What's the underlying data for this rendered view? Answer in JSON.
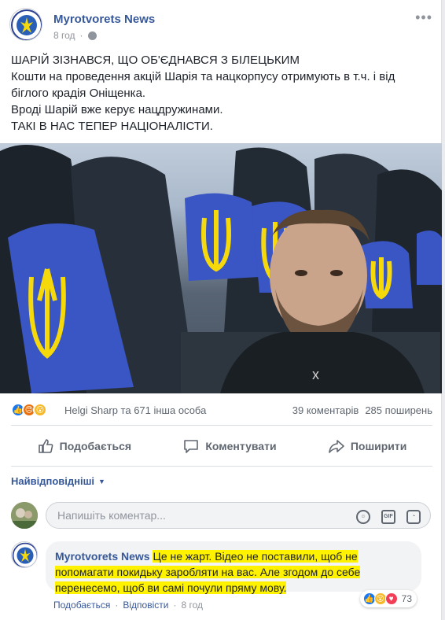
{
  "post": {
    "page_name": "Myrotvorets News",
    "time": "8 год",
    "text_lines": [
      "ШАРІЙ ЗІЗНАВСЯ, ЩО ОБ'ЄДНАВСЯ З БІЛЕЦЬКИМ",
      "Кошти на проведення акцій Шарія та нацкорпусу отримують в т.ч. і від",
      "біглого крадія Оніщенка.",
      "Вроді Шарій вже керує нацдружинами.",
      "ТАКІ В НАС ТЕПЕР НАЦІОНАЛІСТИ."
    ],
    "more_icon": "more-horizontal-icon"
  },
  "reactions": {
    "icons": [
      "like-icon",
      "angry-icon",
      "wow-icon"
    ],
    "reactors": "Helgi Sharp та 671 інша особа",
    "comments": "39 коментарів",
    "shares": "285 поширень"
  },
  "actions": {
    "like": "Подобається",
    "comment": "Коментувати",
    "share": "Поширити"
  },
  "sort": {
    "label": "Найвідповідніші"
  },
  "comment_input": {
    "placeholder": "Напишіть коментар..."
  },
  "comment": {
    "author": "Myrotvorets News",
    "text": "Це не жарт. Відео не поставили, щоб не попомагати покидьку заробляти на вас. Але згодом до себе перенесемо, щоб ви самі почули пряму мову.",
    "reaction_count": "73",
    "like_label": "Подобається",
    "reply_label": "Відповісти",
    "time": "8 год"
  },
  "colors": {
    "link_blue": "#365899",
    "like_blue": "#1877f2",
    "highlight": "#fff200",
    "armband_blue": "#3a55c4",
    "trident_yellow": "#f5d90a"
  }
}
